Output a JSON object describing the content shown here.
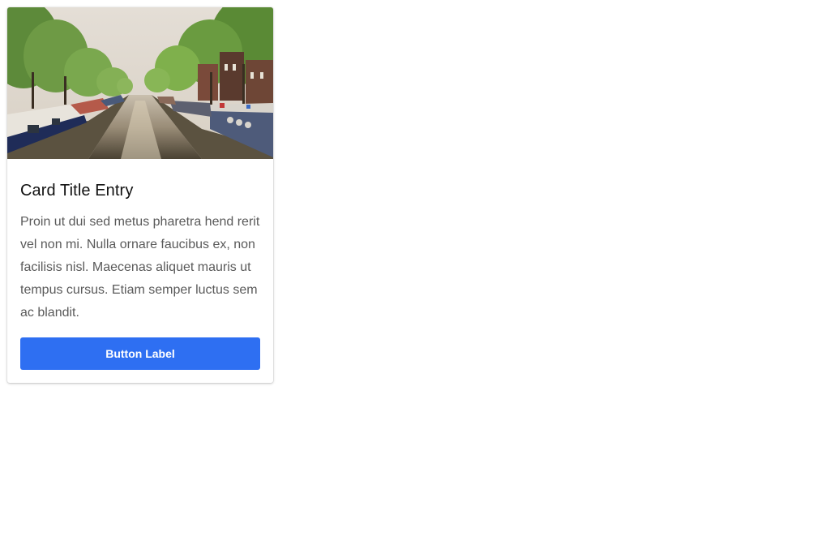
{
  "card": {
    "image_alt": "Canal with houseboats and trees",
    "title": "Card Title Entry",
    "text": "Proin ut dui sed metus pharetra hend rerit vel non mi. Nulla ornare faucibus ex, non facilisis nisl. Maecenas aliquet mauris ut tempus cursus. Etiam semper luctus sem ac blandit.",
    "button_label": "Button Label"
  },
  "colors": {
    "button_bg": "#2e6ff2",
    "title": "#111111",
    "body_text": "#5a5a5a"
  }
}
